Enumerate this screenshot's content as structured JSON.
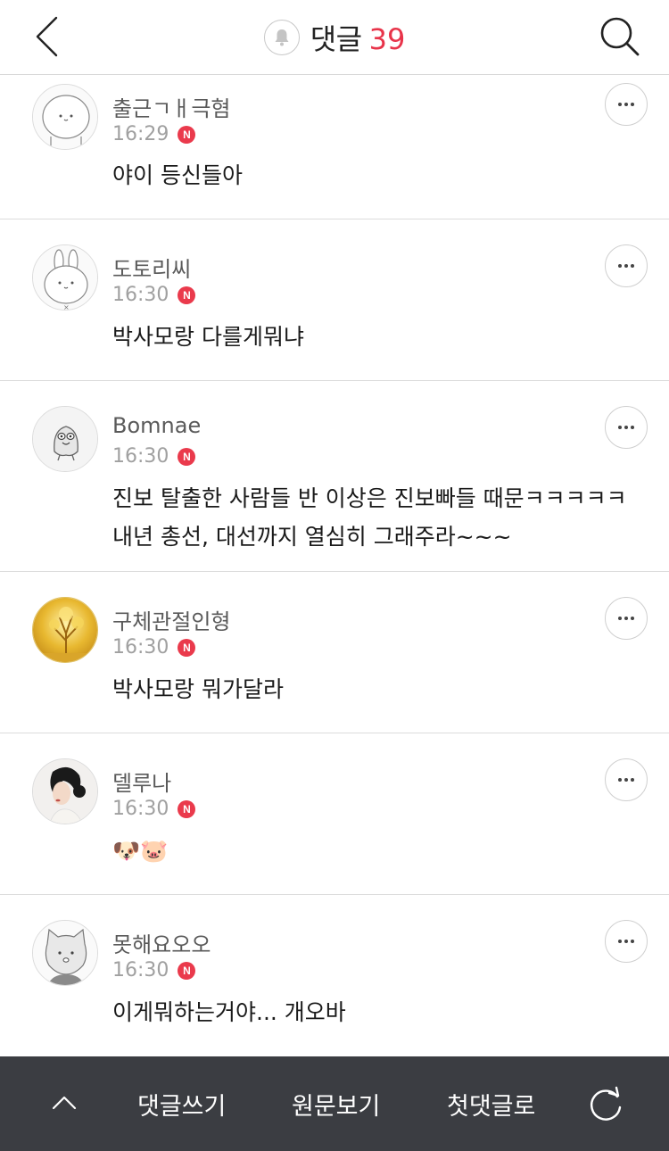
{
  "header": {
    "title": "댓글",
    "count": "39",
    "icons": {
      "back": "chevron-left-icon",
      "bell": "bell-icon",
      "search": "search-icon"
    }
  },
  "colors": {
    "accent": "#e8344a",
    "badge": "#ea3a4c",
    "bottombar": "#3b3d42"
  },
  "comments": [
    {
      "nickname": "출근ㄱㅐ극혐",
      "time": "16:29",
      "badge": "N",
      "text": "야이 등신들아",
      "avatar": "white-blob-character"
    },
    {
      "nickname": "도토리씨",
      "time": "16:30",
      "badge": "N",
      "text": "박사모랑 다를게뭐냐",
      "avatar": "white-rabbit-character"
    },
    {
      "nickname": "Bomnae",
      "time": "16:30",
      "badge": "N",
      "text": "진보 탈출한 사람들 반 이상은 진보빠들 때문ㅋㅋㅋㅋㅋ 내년 총선, 대선까지 열심히 그래주라~~~",
      "avatar": "gray-bird-character"
    },
    {
      "nickname": "구체관절인형",
      "time": "16:30",
      "badge": "N",
      "text": "박사모랑 뭐가달라",
      "avatar": "golden-tree-painting"
    },
    {
      "nickname": "델루나",
      "time": "16:30",
      "badge": "N",
      "text": "🐶🐷",
      "avatar": "woman-portrait"
    },
    {
      "nickname": "못해요오오",
      "time": "16:30",
      "badge": "N",
      "text": "이게뭐하는거야... 개오바",
      "avatar": "gray-cat-character"
    }
  ],
  "bottombar": {
    "write": "댓글쓰기",
    "original": "원문보기",
    "first": "첫댓글로",
    "icons": {
      "up": "chevron-up-icon",
      "refresh": "refresh-icon"
    }
  }
}
